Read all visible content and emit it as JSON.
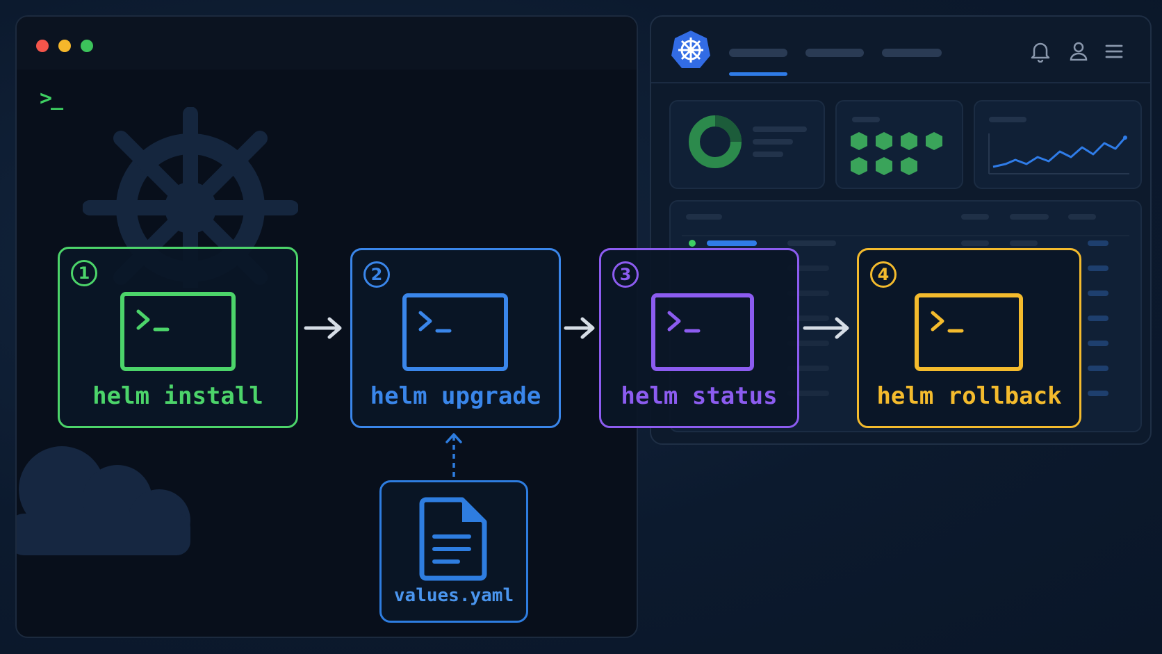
{
  "steps": [
    {
      "number": "1",
      "command": "helm install",
      "color": "#4cd46a"
    },
    {
      "number": "2",
      "command": "helm upgrade",
      "color": "#3a86ea"
    },
    {
      "number": "3",
      "command": "helm status",
      "color": "#8c5cf0"
    },
    {
      "number": "4",
      "command": "helm rollback",
      "color": "#f4bb2d"
    }
  ],
  "terminal": {
    "prompt": ">_"
  },
  "values_file": {
    "name": "values.yaml",
    "color": "#2e7de0"
  },
  "colors": {
    "background": "#0c1a2e",
    "arrow": "#d6dde6",
    "kube_blue": "#326ce5"
  },
  "icons": [
    "helm-wheel-icon",
    "kubernetes-logo-icon",
    "bell-icon",
    "user-icon",
    "menu-icon",
    "terminal-icon",
    "file-icon",
    "cloud-icon"
  ]
}
